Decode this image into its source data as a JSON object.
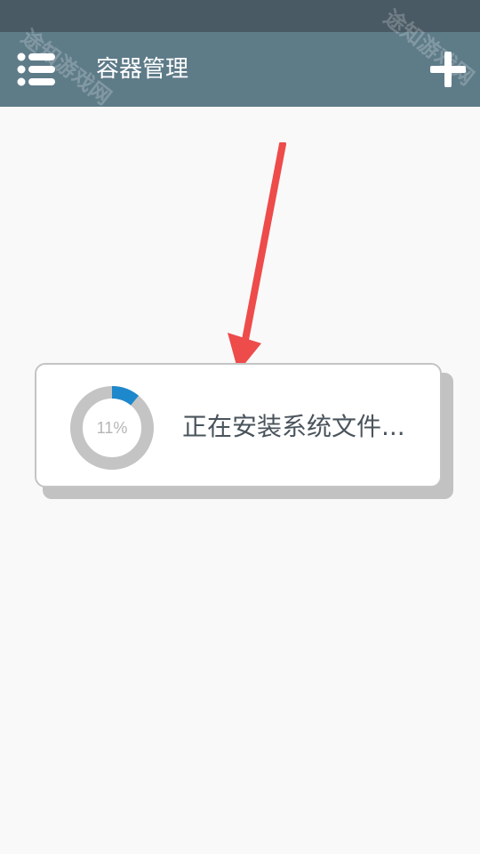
{
  "app_bar": {
    "title": "容器管理",
    "menu_icon": "list-menu-icon",
    "add_icon": "plus-icon"
  },
  "progress_card": {
    "percent_label": "11%",
    "progress": 0.11,
    "message": "正在安装系统文件..."
  },
  "watermark": {
    "text": "途知游戏网"
  },
  "colors": {
    "status_bar": "#4a5a65",
    "app_bar": "#5e7b88",
    "background": "#f9f9f9",
    "progress_track": "#c4c4c4",
    "progress_fill": "#1e88cc",
    "arrow": "#ee4b4b"
  }
}
